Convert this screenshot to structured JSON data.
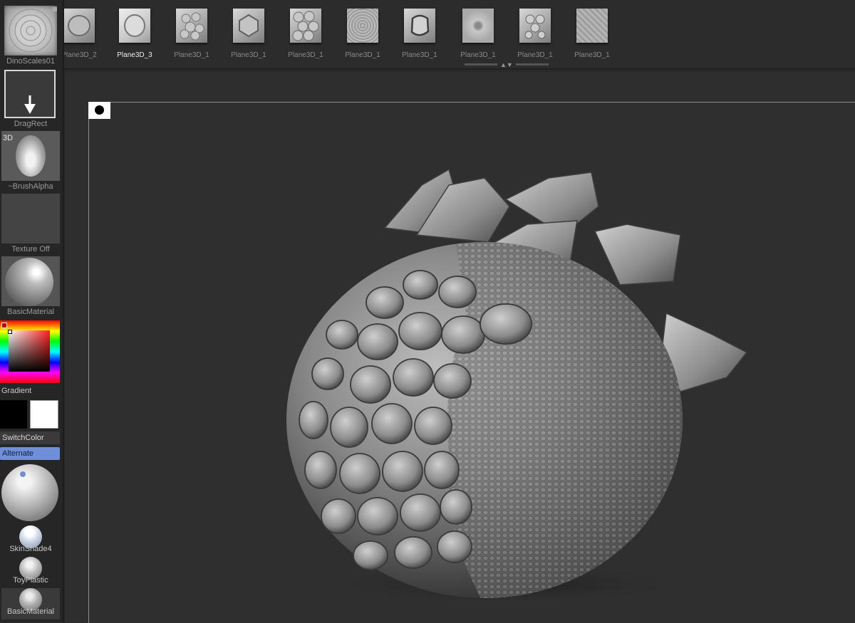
{
  "top_strip": {
    "brushes": [
      {
        "label": "DinoScales01",
        "icon": "scale-alpha-icon"
      },
      {
        "label": "Plane3D_2",
        "icon": "shield-scale-icon"
      },
      {
        "label": "Plane3D_3",
        "icon": "shield-scale-icon"
      },
      {
        "label": "Plane3D_1",
        "icon": "cluster-scales-icon"
      },
      {
        "label": "Plane3D_1",
        "icon": "hex-scale-icon"
      },
      {
        "label": "Plane3D_1",
        "icon": "bubble-scales-icon"
      },
      {
        "label": "Plane3D_1",
        "icon": "fine-scales-icon"
      },
      {
        "label": "Plane3D_1",
        "icon": "plate-scale-icon"
      },
      {
        "label": "Plane3D_1",
        "icon": "dino-scales-icon"
      },
      {
        "label": "Plane3D_1",
        "icon": "round-scales-icon"
      },
      {
        "label": "Plane3D_1",
        "icon": "micro-scales-icon"
      }
    ]
  },
  "left_tray": {
    "alpha_label": "DinoScales01",
    "stroke_label": "DragRect",
    "brush_alpha_badge": "3D",
    "brush_alpha_label": "~BrushAlpha",
    "texture_label": "Texture Off",
    "material_label": "BasicMaterial",
    "gradient_label": "Gradient",
    "switch_color_label": "SwitchColor",
    "alternate_label": "Alternate",
    "materials": [
      {
        "label": "SkinShade4"
      },
      {
        "label": "ToyPlastic"
      },
      {
        "label": "BasicMaterial"
      }
    ]
  },
  "colors": {
    "accent": "#6f8fd8",
    "background": "#2e2e2e",
    "primary_color": "#000000",
    "secondary_color": "#ffffff"
  }
}
